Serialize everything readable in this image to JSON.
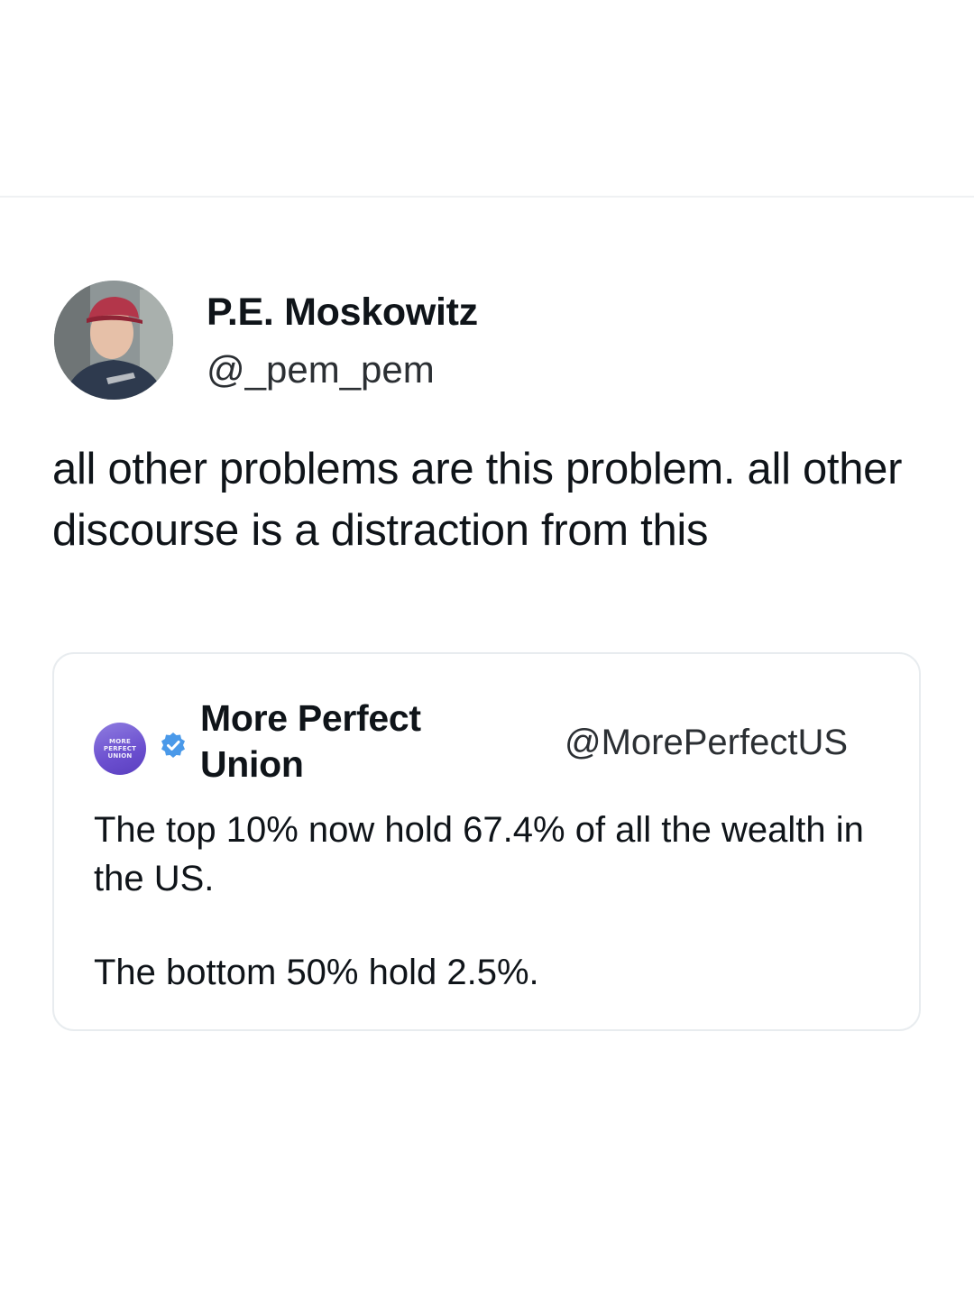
{
  "tweet": {
    "author_name": "P.E. Moskowitz",
    "author_handle": "@_pem_pem",
    "text": "all other problems are this problem. all other discourse is a distraction from this",
    "avatar_icon": "user-photo-avatar"
  },
  "quoted_tweet": {
    "author_name": "More Perfect Union",
    "author_handle": "@MorePerfectUS",
    "avatar_logo_text": "MORE PERFECT UNION",
    "verified_icon": "verified-badge-icon",
    "verified_color": "#4a99e9",
    "text_line_1": "The top 10% now hold 67.4% of all the wealth in the US.",
    "text_line_2": "The bottom 50% hold 2.5%."
  },
  "colors": {
    "background": "#ffffff",
    "text": "#0f1419",
    "border": "#e8ecef"
  }
}
